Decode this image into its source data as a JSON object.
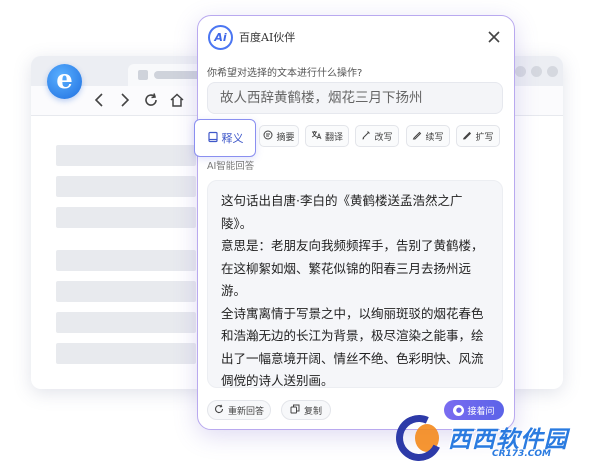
{
  "browser": {
    "logo_letter": "e",
    "nav": {
      "back_icon": "chevron-left-icon",
      "forward_icon": "chevron-right-icon",
      "reload_icon": "reload-icon",
      "home_icon": "home-icon"
    }
  },
  "panel": {
    "logo_text": "Ai",
    "title": "百度AI伙伴",
    "question": "你希望对选择的文本进行什么操作?",
    "selected_text": "故人西辞黄鹤楼，烟花三月下扬州",
    "tools": [
      {
        "label": "释义",
        "icon": "book-icon"
      },
      {
        "label": "摘要",
        "icon": "summary-icon"
      },
      {
        "label": "翻译",
        "icon": "translate-icon"
      },
      {
        "label": "改写",
        "icon": "pen-icon"
      },
      {
        "label": "续写",
        "icon": "pencil-icon"
      },
      {
        "label": "扩写",
        "icon": "expand-pen-icon"
      }
    ],
    "answer_label": "AI智能回答",
    "answer_paragraphs": [
      "这句话出自唐·李白的《黄鹤楼送孟浩然之广陵》。",
      "意思是：老朋友向我频频挥手，告别了黄鹤楼，在这柳絮如烟、繁花似锦的阳春三月去扬州远游。",
      "全诗寓离情于写景之中，以绚丽斑驳的烟花春色和浩瀚无边的长江为背景，极尽渲染之能事，绘出了一幅意境开阔、情丝不绝、色彩明快、风流倜傥的诗人送别画。"
    ],
    "footer": {
      "regenerate_label": "重新回答",
      "copy_label": "复制",
      "ask_label": "接着问"
    }
  },
  "watermark": {
    "text": "西西软件园",
    "sub": "CR173.COM"
  },
  "colors": {
    "accent": "#5b63e8",
    "panel_border": "#b9a9ef",
    "brand_blue": "#4b76f2"
  }
}
